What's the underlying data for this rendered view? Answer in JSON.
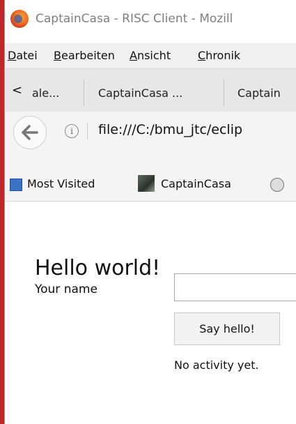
{
  "window": {
    "title": "CaptainCasa - RISC Client - Mozill"
  },
  "menu": {
    "items": [
      {
        "accel": "D",
        "rest": "atei"
      },
      {
        "accel": "B",
        "rest": "earbeiten"
      },
      {
        "accel": "A",
        "rest": "nsicht"
      },
      {
        "accel": "C",
        "rest": "hronik"
      }
    ]
  },
  "tabs": {
    "scroll_glyph": "<",
    "items": [
      "ale...",
      "CaptainCasa ...",
      "Captain"
    ]
  },
  "nav": {
    "info_glyph": "i",
    "url": "file:///C:/bmu_jtc/eclip"
  },
  "bookmarks": {
    "items": [
      "Most Visited",
      "CaptainCasa"
    ]
  },
  "page": {
    "title": "Hello world!",
    "name_label": "Your name",
    "name_value": "",
    "button_label": "Say hello!",
    "status": "No activity yet."
  }
}
